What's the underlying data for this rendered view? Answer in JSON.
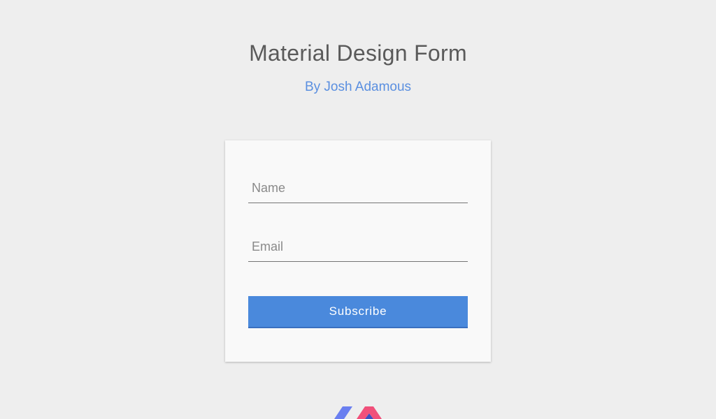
{
  "header": {
    "title": "Material Design Form",
    "byline": "By Josh Adamous"
  },
  "form": {
    "name_placeholder": "Name",
    "email_placeholder": "Email",
    "subscribe_label": "Subscribe"
  },
  "colors": {
    "background": "#eeeeee",
    "card": "#f9f9f9",
    "accent": "#4a89dc",
    "byline": "#5a8fe0",
    "logo_left": "#6a7ff0",
    "logo_right": "#f0507a"
  },
  "icons": {
    "footer_logo": "logo-icon"
  }
}
